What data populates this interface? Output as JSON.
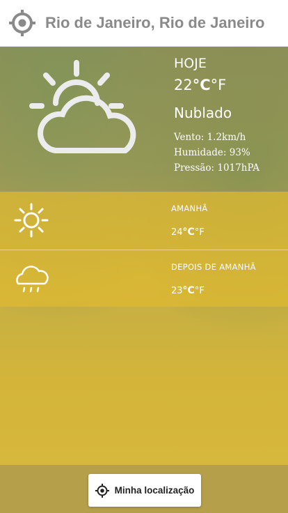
{
  "header": {
    "city": "Rio de Janeiro, Rio de Janeiro",
    "locate_icon": "crosshair-icon"
  },
  "today": {
    "day": "HOJE",
    "temp_value": "22",
    "unit_c": "°C",
    "unit_f": "°F",
    "condition": "Nublado",
    "wind": "Vento: 1.2km/h",
    "humidity": "Humidade: 93%",
    "pressure": "Pressão: 1017hPA",
    "icon": "partly-cloudy-icon"
  },
  "forecast": [
    {
      "label": "AMANHÃ",
      "temp_value": "24",
      "unit_c": "°C",
      "unit_f": "°F",
      "icon": "sun-icon"
    },
    {
      "label": "DEPOIS DE AMANHÃ",
      "temp_value": "23",
      "unit_c": "°C",
      "unit_f": "°F",
      "icon": "rain-cloud-icon"
    }
  ],
  "footer": {
    "my_location_label": "Minha localização",
    "icon": "crosshair-icon"
  },
  "colors": {
    "header_text": "#8a8a8a",
    "forecast_band": "#e0ba30",
    "footer_bar": "#b59f4a"
  }
}
